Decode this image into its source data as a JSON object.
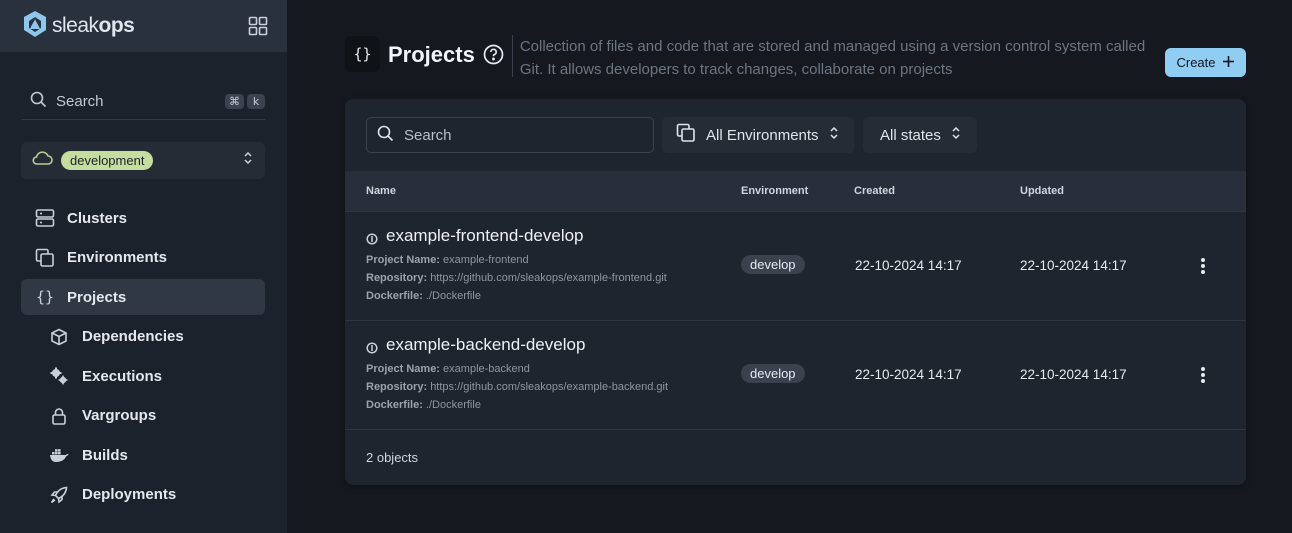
{
  "brand": {
    "name_light": "sleak",
    "name_bold": "ops"
  },
  "sidebar": {
    "search_label": "Search",
    "shortcut_keys": [
      "⌘",
      "k"
    ],
    "environment": "development",
    "items": [
      {
        "label": "Clusters",
        "icon": "server-icon"
      },
      {
        "label": "Environments",
        "icon": "copy-icon"
      },
      {
        "label": "Projects",
        "icon": "braces-icon",
        "active": true
      },
      {
        "label": "Dependencies",
        "icon": "cube-icon"
      },
      {
        "label": "Executions",
        "icon": "cogs-icon"
      },
      {
        "label": "Vargroups",
        "icon": "lock-icon"
      },
      {
        "label": "Builds",
        "icon": "docker-icon"
      },
      {
        "label": "Deployments",
        "icon": "rocket-icon"
      }
    ]
  },
  "header": {
    "icon_text": "{}",
    "title": "Projects",
    "description": "Collection of files and code that are stored and managed using a version control system called Git. It allows developers to track changes, collaborate on projects",
    "create_label": "Create"
  },
  "filters": {
    "search_placeholder": "Search",
    "environments": "All Environments",
    "states": "All states"
  },
  "table": {
    "columns": [
      "Name",
      "Environment",
      "Created",
      "Updated"
    ],
    "meta_labels": {
      "project_name": "Project Name:",
      "repository": "Repository:",
      "dockerfile": "Dockerfile:"
    },
    "rows": [
      {
        "name": "example-frontend-develop",
        "project_name": "example-frontend",
        "repository": "https://github.com/sleakops/example-frontend.git",
        "dockerfile": "./Dockerfile",
        "environment": "develop",
        "created": "22-10-2024 14:17",
        "updated": "22-10-2024 14:17"
      },
      {
        "name": "example-backend-develop",
        "project_name": "example-backend",
        "repository": "https://github.com/sleakops/example-backend.git",
        "dockerfile": "./Dockerfile",
        "environment": "develop",
        "created": "22-10-2024 14:17",
        "updated": "22-10-2024 14:17"
      }
    ],
    "footer": "2 objects"
  },
  "colors": {
    "accent": "#8fcdf3",
    "env_pill": "#c5dd9e",
    "sidebar_bg": "#1c222b",
    "page_bg": "#15191f"
  }
}
